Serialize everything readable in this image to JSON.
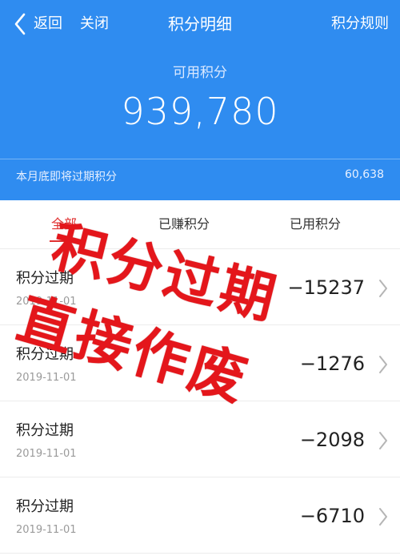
{
  "nav": {
    "back_label": "返回",
    "close_label": "关闭",
    "title": "积分明细",
    "rules_label": "积分规则"
  },
  "balance": {
    "label": "可用积分",
    "value": "939,780"
  },
  "expiring": {
    "label": "本月底即将过期积分",
    "value": "60,638"
  },
  "tabs": [
    {
      "label": "全部",
      "active": true
    },
    {
      "label": "已赚积分",
      "active": false
    },
    {
      "label": "已用积分",
      "active": false
    }
  ],
  "records": [
    {
      "title": "积分过期",
      "date": "2019-11-01",
      "amount": "−15237"
    },
    {
      "title": "积分过期",
      "date": "2019-11-01",
      "amount": "−1276"
    },
    {
      "title": "积分过期",
      "date": "2019-11-01",
      "amount": "−2098"
    },
    {
      "title": "积分过期",
      "date": "2019-11-01",
      "amount": "−6710"
    }
  ],
  "stamp": {
    "line1": "积分过期",
    "line2": "直接作废"
  },
  "colors": {
    "header_bg": "#2f8cf0",
    "active_tab": "#e03030",
    "stamp": "#e4161b"
  },
  "icons": {
    "back": "chevron-left-icon",
    "row_arrow": "chevron-right-icon"
  }
}
